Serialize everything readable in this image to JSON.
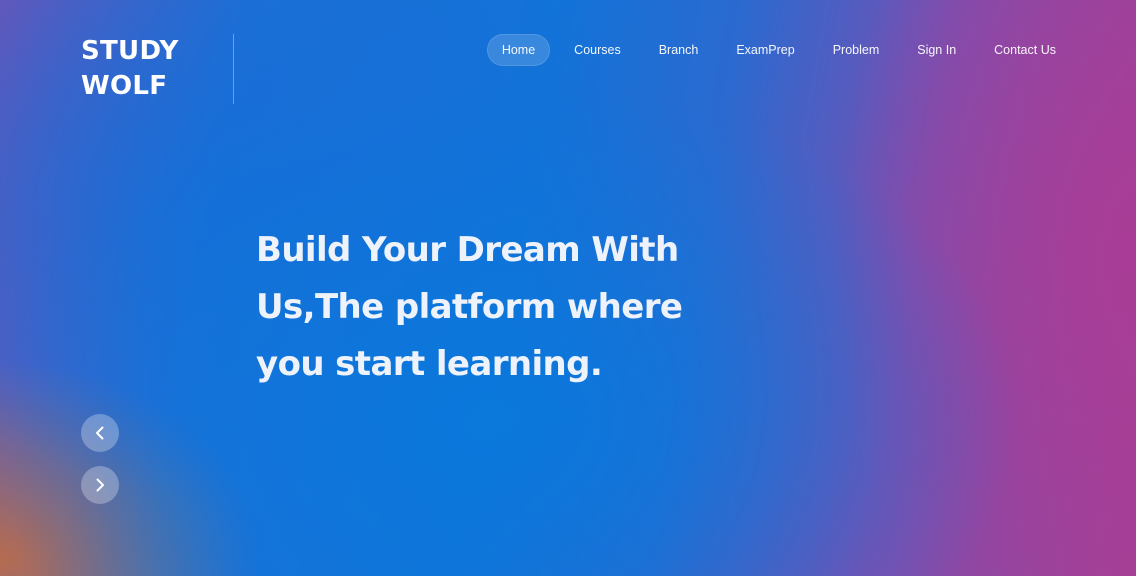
{
  "brand": {
    "line1": "STUDY",
    "line2": "WOLF"
  },
  "nav": {
    "items": [
      {
        "label": "Home",
        "active": true
      },
      {
        "label": "Courses",
        "active": false
      },
      {
        "label": "Branch",
        "active": false
      },
      {
        "label": "ExamPrep",
        "active": false
      },
      {
        "label": "Problem",
        "active": false
      },
      {
        "label": "Sign In",
        "active": false
      },
      {
        "label": "Contact Us",
        "active": false
      }
    ]
  },
  "hero": {
    "line1": "Build Your Dream With",
    "line2": "Us,The platform where",
    "line3": "you start learning."
  },
  "slider": {
    "prev_icon": "chevron-left-icon",
    "next_icon": "chevron-right-icon"
  },
  "colors": {
    "primary_blue": "#1273d8",
    "accent_magenta": "#a43f94",
    "text": "#ffffff"
  }
}
